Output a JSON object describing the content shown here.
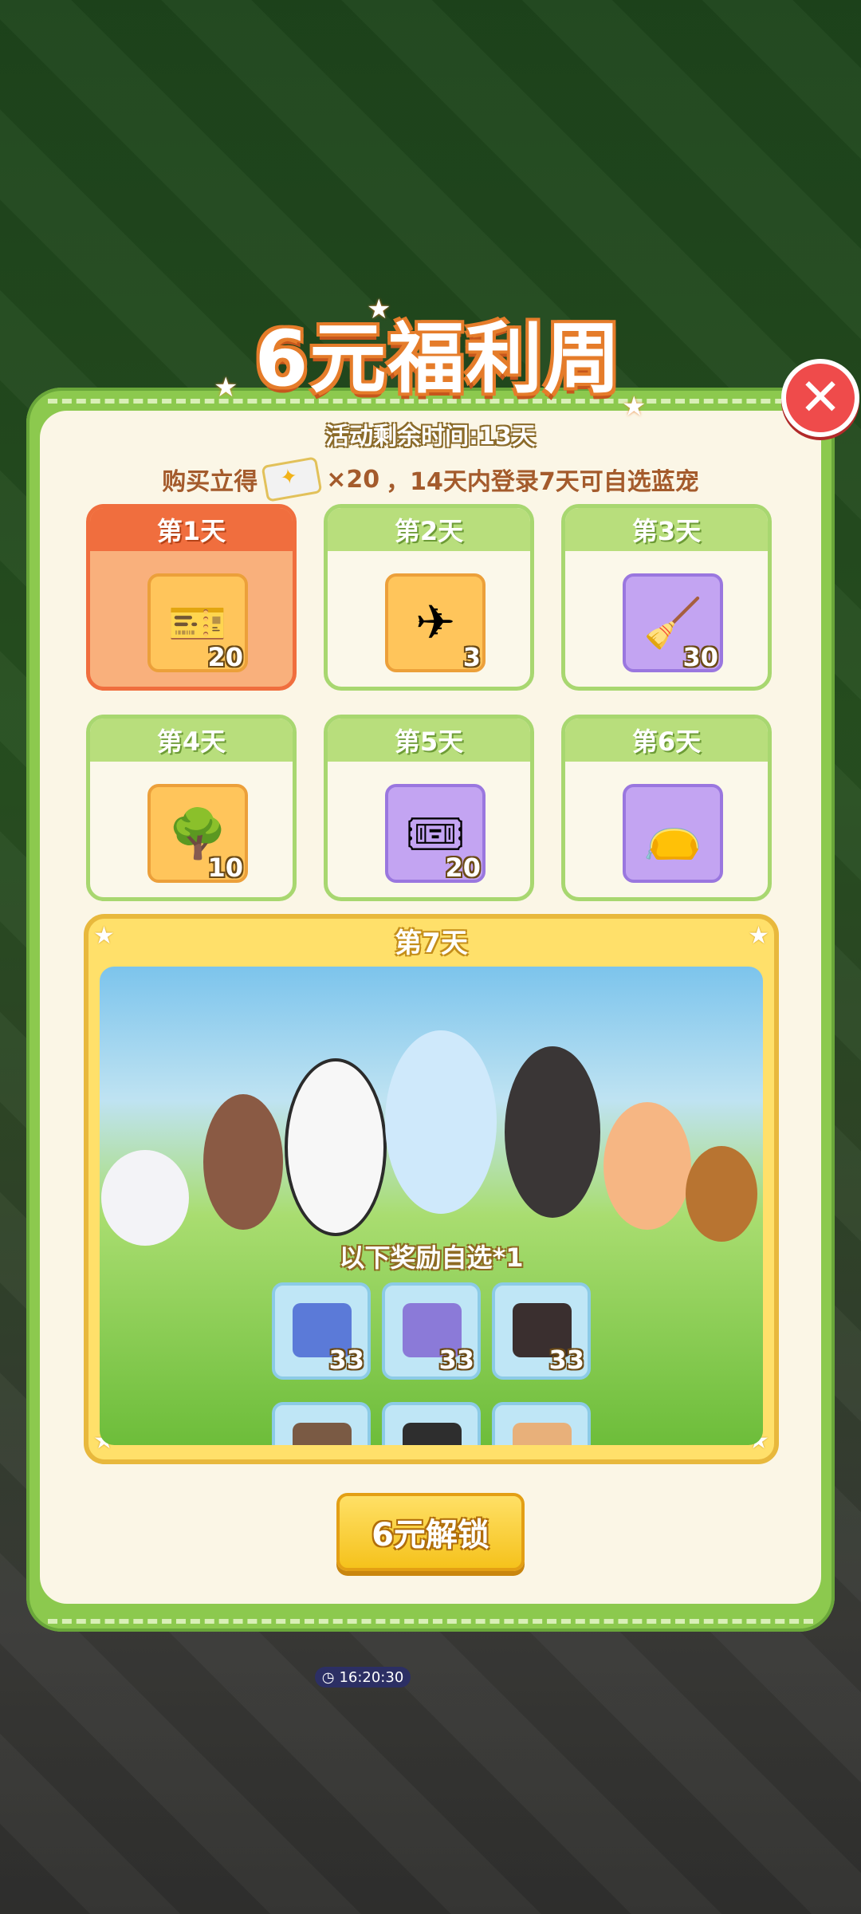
{
  "title": "6元福利周",
  "subtitle": "活动剩余时间:13天",
  "description": {
    "prefix": "购买立得",
    "ticket_count": "×20",
    "suffix": "，14天内登录7天可自选蓝宠"
  },
  "days": [
    {
      "label": "第1天",
      "icon": "sparkle-ticket-icon",
      "count": "20"
    },
    {
      "label": "第2天",
      "icon": "plane-ticket-icon",
      "count": "3"
    },
    {
      "label": "第3天",
      "icon": "broom-icon",
      "count": "30"
    },
    {
      "label": "第4天",
      "icon": "wisteria-tree-icon",
      "count": "10"
    },
    {
      "label": "第5天",
      "icon": "gold-ticket-icon",
      "count": "20"
    },
    {
      "label": "第6天",
      "icon": "yellow-pouch-icon",
      "count": ""
    }
  ],
  "day7": {
    "label": "第7天",
    "choose_label": "以下奖励自选*1",
    "rewards": [
      {
        "count": "33"
      },
      {
        "count": "33"
      },
      {
        "count": "33"
      }
    ]
  },
  "unlock_button": "6元解锁",
  "background_timer": "16:20:30"
}
